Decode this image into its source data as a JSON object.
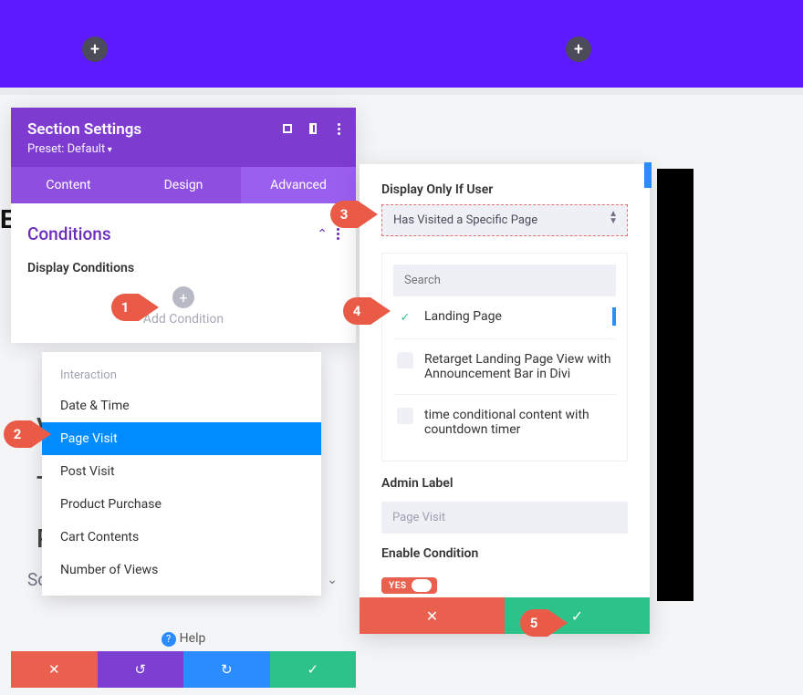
{
  "topbar": {
    "add_left": "+",
    "add_right": "+"
  },
  "leftPanel": {
    "title": "Section Settings",
    "preset": "Preset: Default",
    "tabs": {
      "content": "Content",
      "design": "Design",
      "advanced": "Advanced"
    },
    "conditions": {
      "title": "Conditions",
      "display_label": "Display Conditions",
      "add_label": "Add Condition",
      "dropdown": {
        "category": "Interaction",
        "items": [
          "Date & Time",
          "Page Visit",
          "Post Visit",
          "Product Purchase",
          "Cart Contents",
          "Number of Views"
        ],
        "selected": "Page Visit"
      }
    },
    "scroll_effects": "Scroll Effects",
    "help": "Help"
  },
  "rightPanel": {
    "display_label": "Display Only If User",
    "select_value": "Has Visited a Specific Page",
    "search_placeholder": "Search",
    "pages": [
      {
        "label": "Landing Page",
        "checked": true,
        "highlight": true
      },
      {
        "label": "Retarget Landing Page View with Announcement Bar in Divi",
        "checked": false,
        "highlight": false
      },
      {
        "label": "time conditional content with countdown timer",
        "checked": false,
        "highlight": false
      }
    ],
    "admin_label": "Admin Label",
    "admin_value": "Page Visit",
    "enable_label": "Enable Condition",
    "toggle_text": "YES"
  },
  "callouts": {
    "c1": "1",
    "c2": "2",
    "c3": "3",
    "c4": "4",
    "c5": "5"
  },
  "bg": {
    "v": "V",
    "t": "T",
    "p": "P",
    "e": "E"
  }
}
